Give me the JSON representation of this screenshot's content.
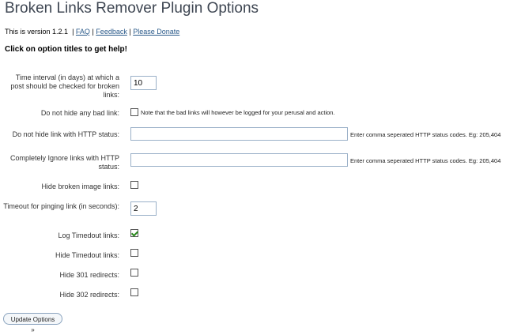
{
  "page": {
    "title": "Broken Links Remover Plugin Options",
    "version_text": "This is version 1.2.1",
    "separator": "|",
    "links": [
      "FAQ",
      "Feedback",
      "Please Donate"
    ],
    "help_heading": "Click on option titles to get help!"
  },
  "options": {
    "time_interval": {
      "label": "Time interval (in days) at which a post should be checked for broken links:",
      "value": "10"
    },
    "do_not_hide_bad": {
      "label": "Do not hide any bad link:",
      "checked": false,
      "note": "Note that the bad links will however be logged for your perusal and action."
    },
    "do_not_hide_status": {
      "label": "Do not hide link with HTTP status:",
      "value": "",
      "note": "Enter comma seperated HTTP status codes. Eg: 205,404"
    },
    "ignore_status": {
      "label": "Completely Ignore links with HTTP status:",
      "value": "",
      "note": "Enter comma seperated HTTP status codes. Eg: 205,404"
    },
    "hide_broken_images": {
      "label": "Hide broken image links:",
      "checked": false
    },
    "timeout": {
      "label": "Timeout for pinging link (in seconds):",
      "value": "2"
    },
    "log_timedout": {
      "label": "Log Timedout links:",
      "checked": true
    },
    "hide_timedout": {
      "label": "Hide Timedout links:",
      "checked": false
    },
    "hide_301": {
      "label": "Hide 301 redirects:",
      "checked": false
    },
    "hide_302": {
      "label": "Hide 302 redirects:",
      "checked": false
    }
  },
  "update_button": {
    "label": "Update Options »"
  },
  "colors": {
    "title": "#3e4652",
    "link": "#2a5a8a",
    "check": "#2b8a1e",
    "field_border": "#9ab0c8"
  }
}
